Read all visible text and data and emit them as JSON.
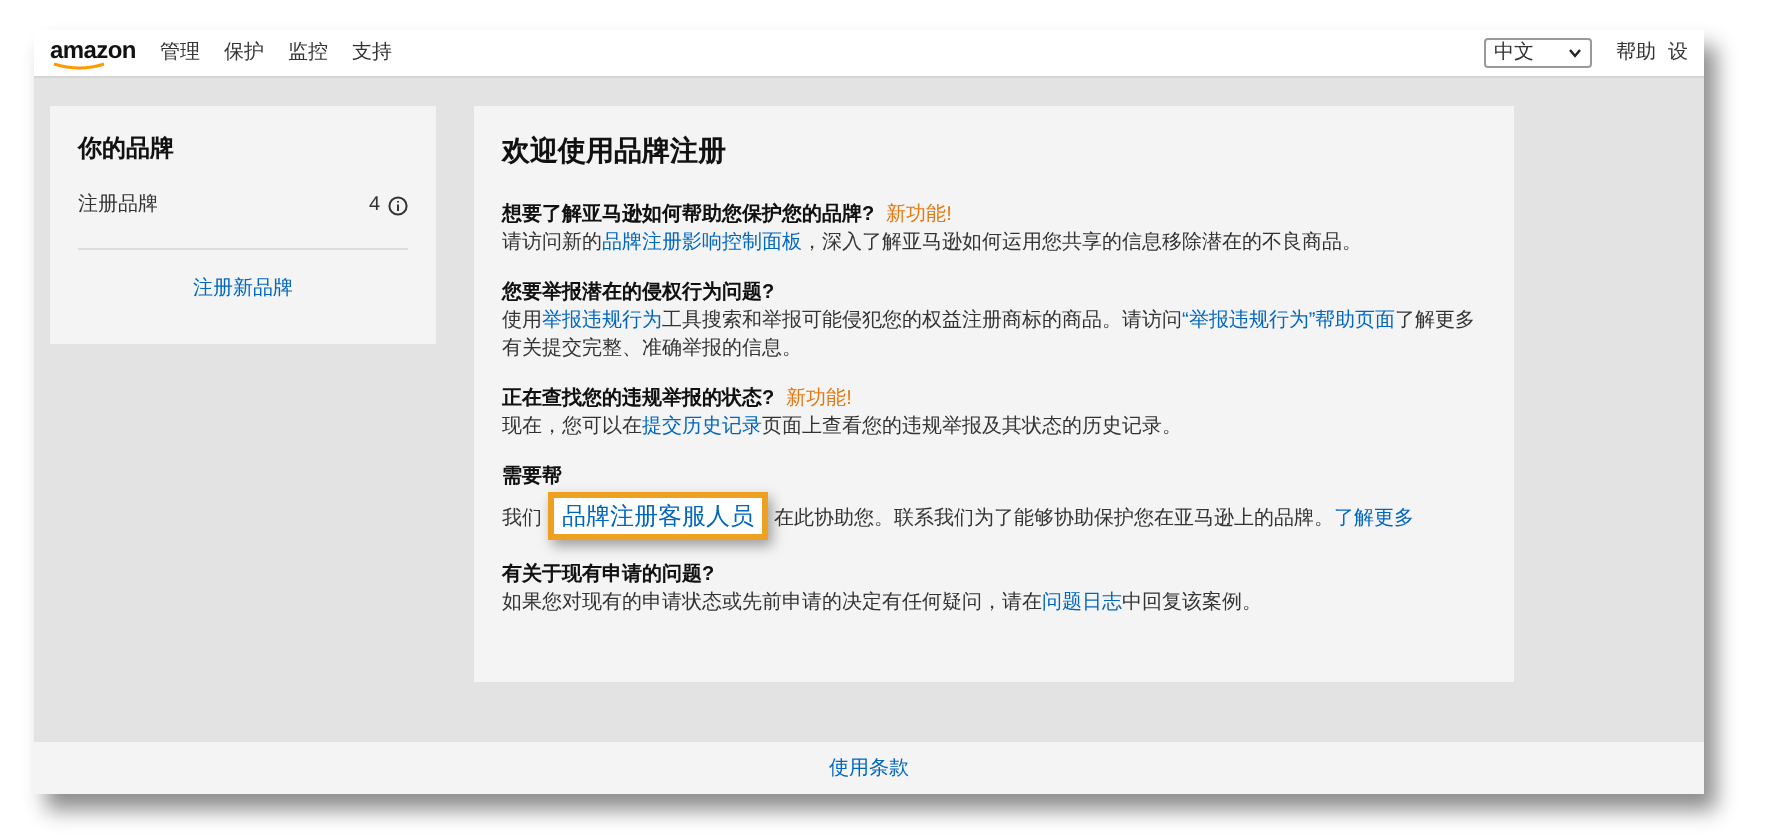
{
  "nav": {
    "logo": "amazon",
    "links": [
      "管理",
      "保护",
      "监控",
      "支持"
    ],
    "language": "中文",
    "help": "帮助",
    "settings": "设"
  },
  "brands_card": {
    "title": "你的品牌",
    "rows": [
      {
        "label": "注册品牌",
        "count": "4"
      }
    ],
    "link": "注册新品牌"
  },
  "welcome": {
    "title": "欢迎使用品牌注册",
    "sections": [
      {
        "heading": "想要了解亚马逊如何帮助您保护您的品牌?",
        "badge": "新功能!",
        "body": [
          {
            "kind": "text",
            "text": "请访问新的"
          },
          {
            "kind": "link",
            "text": "品牌注册影响控制面板"
          },
          {
            "kind": "text",
            "text": "，深入了解亚马逊如何运用您共享的信息移除潜在的不良商品。"
          }
        ]
      },
      {
        "heading": "您要举报潜在的侵权行为问题?",
        "body": [
          {
            "kind": "text",
            "text": "使用"
          },
          {
            "kind": "link",
            "text": "举报违规行为"
          },
          {
            "kind": "text",
            "text": "工具搜索和举报可能侵犯您的权益注册商标的商品。请访问"
          },
          {
            "kind": "link",
            "text": "“举报违规行为”帮助页面"
          },
          {
            "kind": "text",
            "text": "了解更多有关提交完整、准确举报的信息。"
          }
        ]
      },
      {
        "heading": "正在查找您的违规举报的状态?",
        "badge": "新功能!",
        "body": [
          {
            "kind": "text",
            "text": "现在，您可以在"
          },
          {
            "kind": "link",
            "text": "提交历史记录"
          },
          {
            "kind": "text",
            "text": "页面上查看您的违规举报及其状态的历史记录。"
          }
        ]
      },
      {
        "heading": "需要帮",
        "body": [
          {
            "kind": "text",
            "text": "我们"
          },
          {
            "kind": "callout",
            "text": "品牌注册客服人员"
          },
          {
            "kind": "text",
            "text": "在此协助您。联系我们为了能够协助保护您在亚马逊上的品牌。"
          },
          {
            "kind": "link",
            "text": "了解更多"
          }
        ]
      },
      {
        "heading": "有关于现有申请的问题?",
        "body": [
          {
            "kind": "text",
            "text": "如果您对现有的申请状态或先前申请的决定有任何疑问，请在"
          },
          {
            "kind": "link",
            "text": "问题日志"
          },
          {
            "kind": "text",
            "text": "中回复该案例。"
          }
        ]
      }
    ]
  },
  "footer": {
    "link": "使用条款"
  }
}
